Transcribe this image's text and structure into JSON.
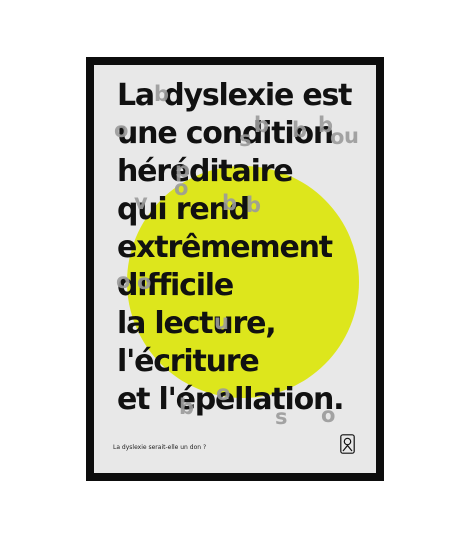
{
  "poster": {
    "lines": [
      "La dyslexie est",
      "une condition",
      "héréditaire",
      "qui rend",
      "extrêmement",
      "difficile",
      "la lecture,",
      "l'écriture",
      "et l'épellation."
    ],
    "overlay_letters": [
      "b",
      "o",
      "b",
      "b",
      "b",
      "s",
      "o",
      "u",
      "p",
      "o",
      "b",
      "b",
      "v",
      "o",
      "o",
      "u",
      "o",
      "b",
      "s",
      "o"
    ],
    "question": "La dyslexie serait-elle un don ?",
    "colors": {
      "frame": "#0d0d0d",
      "paper": "#e8e8e8",
      "circle": "#dde61c",
      "text": "#111111",
      "overlay": "#9b9b9b"
    },
    "logo_icon": "dyslexia-logo-icon"
  }
}
